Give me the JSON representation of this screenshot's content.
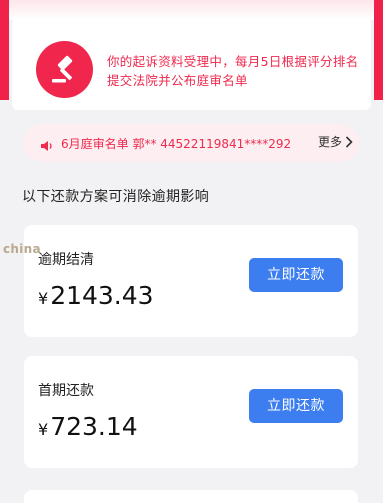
{
  "notice": {
    "icon": "gavel-icon",
    "text": "你的起诉资料受理中，每月5日根据评分排名提交法院并公布庭审名单",
    "color": "#ee2a4e"
  },
  "marquee": {
    "icon": "speaker-icon",
    "text": "6月庭审名单 郭** 44522119841****292",
    "more_label": "更多"
  },
  "section": {
    "title": "以下还款方案可消除逾期影响"
  },
  "watermark": {
    "text": "china"
  },
  "plans": [
    {
      "label": "逾期结清",
      "currency": "¥",
      "amount": "2143.43",
      "button_label": "立即还款"
    },
    {
      "label": "首期还款",
      "currency": "¥",
      "amount": "723.14",
      "button_label": "立即还款"
    }
  ],
  "colors": {
    "accent_red": "#f0264c",
    "button_blue": "#3c7ef0"
  }
}
